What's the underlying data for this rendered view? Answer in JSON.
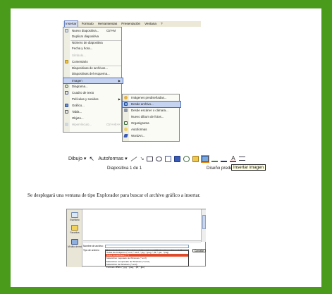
{
  "menubar": {
    "items": [
      "Insertar",
      "Formato",
      "Herramientas",
      "Presentación",
      "Ventana",
      "?"
    ],
    "active_index": 0
  },
  "insert_menu": {
    "items": [
      {
        "label": "Nuevo diapositiva...",
        "shortcut": "Ctrl+M"
      },
      {
        "label": "Duplicar diapositiva"
      },
      {
        "label": "Número de diapositiva"
      },
      {
        "label": "Fecha y hora..."
      },
      {
        "label": "Símbolo...",
        "disabled": true
      },
      {
        "label": "Comentario"
      },
      {
        "label": "Diapositivas de archivos..."
      },
      {
        "label": "Diapositivas del esquema..."
      },
      {
        "label": "Imagen",
        "has_submenu": true,
        "selected": true
      },
      {
        "label": "Diagrama..."
      },
      {
        "label": "Cuadro de texto"
      },
      {
        "label": "Películas y sonidos",
        "has_submenu": true
      },
      {
        "label": "Gráfico..."
      },
      {
        "label": "Tabla..."
      },
      {
        "label": "Objeto..."
      },
      {
        "label": "Hipervínculo...",
        "shortcut": "Ctrl+Alt+K",
        "disabled": true
      }
    ]
  },
  "image_submenu": {
    "items": [
      {
        "label": "Imágenes prediseñadas..."
      },
      {
        "label": "Desde archivo...",
        "selected": true
      },
      {
        "label": "Desde escáner o cámara..."
      },
      {
        "label": "Nuevo álbum de fotos..."
      },
      {
        "label": "Organigrama"
      },
      {
        "label": "Autoformas"
      },
      {
        "label": "WordArt..."
      }
    ]
  },
  "drawing_toolbar": {
    "draw_label": "Dibujo",
    "autoshapes_label": "Autoformas",
    "slide_status": "Diapositiva 1 de 1",
    "design_status": "Diseño predeterminado",
    "tooltip": "Insertar imagen"
  },
  "paragraph": "Se desplegará una ventana de tipo Explorador para buscar el archivo gráfico a insertar.",
  "file_dialog": {
    "places": [
      "Escritorio",
      "Favoritos",
      "Mi sitio de red"
    ],
    "filename_label": "Nombre de archivo:",
    "filetype_label": "Tipo de archivo:",
    "filetype_value": "Todas las imágenes (*.emf; *.wmf; *.jpg; *.jpeg; *.jfif; *.jpe; *.png; *.bmp; *.dib",
    "cancel_label": "Cancelar",
    "dropdown_items": [
      "Todas las imágenes (*.emf; *.wmf; *.jpg; *.jpeg; *.jfif; *.jpe; *.png)",
      "Todos los archivos (*.*)",
      "Metarchivo mejorado de Windows (*.emf)",
      "Metarchivo comprimido de Windows (*.wmz)",
      "Metarchivo de Windows (*.wmf)",
      "Formato JPEG (*.jpg; *.jpeg; *.jfif; *.jpe)",
      "Formato PNG (*.png)"
    ],
    "dropdown_selected_index": 1
  },
  "colors": {
    "frame": "#4a9a1c",
    "menu_highlight": "#c6d3f0",
    "dropdown_highlight": "#e04a2a"
  }
}
